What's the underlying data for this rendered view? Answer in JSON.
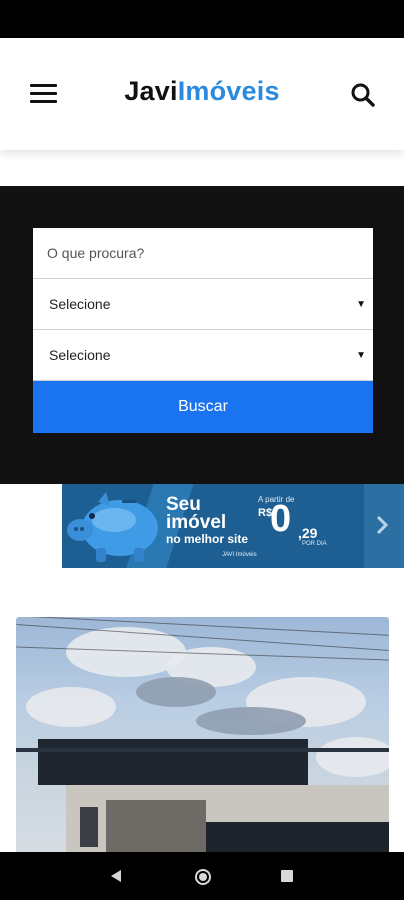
{
  "header": {
    "logo_part1": "Javi",
    "logo_part2": "Imóveis"
  },
  "search": {
    "query_placeholder": "O que procura?",
    "select1_value": "Selecione",
    "select2_value": "Selecione",
    "submit_label": "Buscar"
  },
  "banner": {
    "line1": "Seu",
    "line2": "imóvel",
    "line3": "no melhor site",
    "price_prefix": "A partir de",
    "currency": "R$",
    "price_main": "0",
    "price_cents": ",29",
    "per_day": "POR DIA",
    "brand": "JAVI Imóveis"
  },
  "colors": {
    "logo_accent": "#2b8ae0",
    "button_blue": "#1a73f0",
    "banner_blue": "#1d5f92"
  },
  "icons": {
    "menu": "hamburger-icon",
    "search": "search-icon",
    "banner_next": "chevron-right-icon",
    "nav_back": "triangle-back-icon",
    "nav_home": "circle-home-icon",
    "nav_recent": "square-recent-icon"
  }
}
